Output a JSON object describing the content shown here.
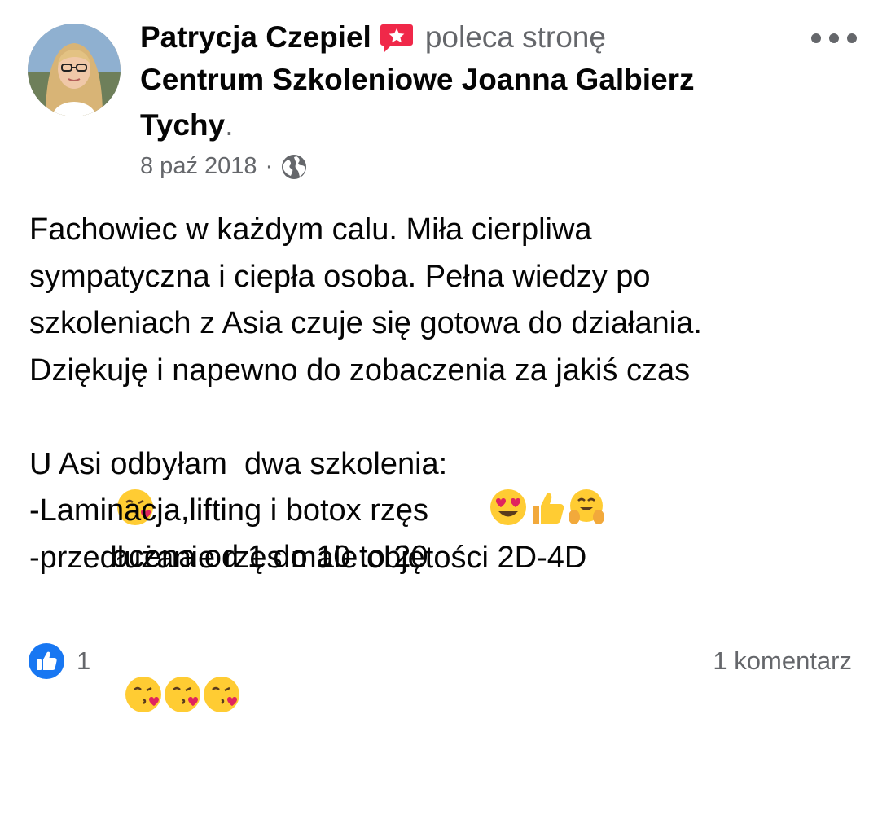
{
  "post": {
    "author": "Patrycja Czepiel",
    "action": "poleca stronę",
    "page_name_line1": "Centrum Szkoleniowe Joanna Galbierz",
    "page_name_line2": "Tychy",
    "punctuation": ".",
    "date": "8 paź 2018",
    "separator": "·",
    "privacy_icon": "globe-icon",
    "recommend_icon": "recommend-badge-icon",
    "more_icon": "more-options-icon"
  },
  "body": {
    "line1": "Fachowiec w każdym calu. Miła cierpliwa",
    "line2": "sympatyczna i ciepła osoba. Pełna wiedzy po",
    "line3": "szkoleniach z Asia czuje się gotowa do działania.",
    "line4": "Dziękuję i napewno do zobaczenia za jakiś czas",
    "line5_text": " ocena od 1 do 10 to 20 ",
    "line6": "U Asi odbyłam  dwa szkolenia:",
    "line7": "-Laminacja,lifting i botox rzęs",
    "line8": "-przedłużanie rzęs male objętości 2D-4D",
    "emojis": {
      "kiss": "face-blowing-kiss-emoji",
      "heart_eyes": "heart-eyes-emoji",
      "thumbs_up": "thumbs-up-emoji",
      "hug": "hugging-face-emoji"
    }
  },
  "footer": {
    "like_icon": "like-reaction-icon",
    "like_count": "1",
    "comments": "1 komentarz"
  },
  "colors": {
    "text": "#050505",
    "secondary": "#65676b",
    "like_blue": "#1877f2",
    "badge_red": "#f02849",
    "emoji_yellow": "#ffcc33"
  }
}
